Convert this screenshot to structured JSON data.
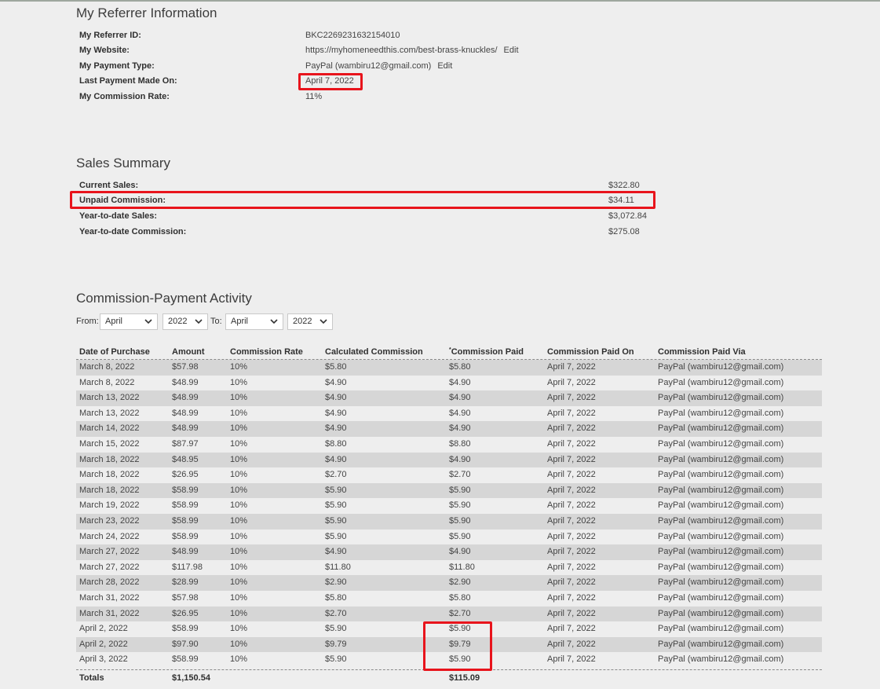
{
  "referrer": {
    "title": "My Referrer Information",
    "fields": [
      {
        "label": "My Referrer ID:",
        "value": "BKC2269231632154010"
      },
      {
        "label": "My Website:",
        "value": "https://myhomeneedthis.com/best-brass-knuckles/",
        "edit": "Edit"
      },
      {
        "label": "My Payment Type:",
        "value": "PayPal (wambiru12@gmail.com)",
        "edit": "Edit"
      },
      {
        "label": "Last Payment Made On:",
        "value": "April 7, 2022"
      },
      {
        "label": "My Commission Rate:",
        "value": "11%"
      }
    ]
  },
  "sales": {
    "title": "Sales Summary",
    "rows": [
      {
        "label": "Current Sales:",
        "value": "$322.80"
      },
      {
        "label": "Unpaid Commission:",
        "value": "$34.11"
      },
      {
        "label": "Year-to-date Sales:",
        "value": "$3,072.84"
      },
      {
        "label": "Year-to-date Commission:",
        "value": "$275.08"
      }
    ]
  },
  "activity": {
    "title": "Commission-Payment Activity",
    "from_label": "From:",
    "to_label": "To:",
    "from_month": "April",
    "from_year": "2022",
    "to_month": "April",
    "to_year": "2022",
    "headers": [
      "Date of Purchase",
      "Amount",
      "Commission Rate",
      "Calculated Commission",
      "Commission Paid",
      "Commission Paid On",
      "Commission Paid Via"
    ],
    "paid_marker": "*",
    "rows": [
      [
        "March 8, 2022",
        "$57.98",
        "10%",
        "$5.80",
        "$5.80",
        "April 7, 2022",
        "PayPal (wambiru12@gmail.com)"
      ],
      [
        "March 8, 2022",
        "$48.99",
        "10%",
        "$4.90",
        "$4.90",
        "April 7, 2022",
        "PayPal (wambiru12@gmail.com)"
      ],
      [
        "March 13, 2022",
        "$48.99",
        "10%",
        "$4.90",
        "$4.90",
        "April 7, 2022",
        "PayPal (wambiru12@gmail.com)"
      ],
      [
        "March 13, 2022",
        "$48.99",
        "10%",
        "$4.90",
        "$4.90",
        "April 7, 2022",
        "PayPal (wambiru12@gmail.com)"
      ],
      [
        "March 14, 2022",
        "$48.99",
        "10%",
        "$4.90",
        "$4.90",
        "April 7, 2022",
        "PayPal (wambiru12@gmail.com)"
      ],
      [
        "March 15, 2022",
        "$87.97",
        "10%",
        "$8.80",
        "$8.80",
        "April 7, 2022",
        "PayPal (wambiru12@gmail.com)"
      ],
      [
        "March 18, 2022",
        "$48.95",
        "10%",
        "$4.90",
        "$4.90",
        "April 7, 2022",
        "PayPal (wambiru12@gmail.com)"
      ],
      [
        "March 18, 2022",
        "$26.95",
        "10%",
        "$2.70",
        "$2.70",
        "April 7, 2022",
        "PayPal (wambiru12@gmail.com)"
      ],
      [
        "March 18, 2022",
        "$58.99",
        "10%",
        "$5.90",
        "$5.90",
        "April 7, 2022",
        "PayPal (wambiru12@gmail.com)"
      ],
      [
        "March 19, 2022",
        "$58.99",
        "10%",
        "$5.90",
        "$5.90",
        "April 7, 2022",
        "PayPal (wambiru12@gmail.com)"
      ],
      [
        "March 23, 2022",
        "$58.99",
        "10%",
        "$5.90",
        "$5.90",
        "April 7, 2022",
        "PayPal (wambiru12@gmail.com)"
      ],
      [
        "March 24, 2022",
        "$58.99",
        "10%",
        "$5.90",
        "$5.90",
        "April 7, 2022",
        "PayPal (wambiru12@gmail.com)"
      ],
      [
        "March 27, 2022",
        "$48.99",
        "10%",
        "$4.90",
        "$4.90",
        "April 7, 2022",
        "PayPal (wambiru12@gmail.com)"
      ],
      [
        "March 27, 2022",
        "$117.98",
        "10%",
        "$11.80",
        "$11.80",
        "April 7, 2022",
        "PayPal (wambiru12@gmail.com)"
      ],
      [
        "March 28, 2022",
        "$28.99",
        "10%",
        "$2.90",
        "$2.90",
        "April 7, 2022",
        "PayPal (wambiru12@gmail.com)"
      ],
      [
        "March 31, 2022",
        "$57.98",
        "10%",
        "$5.80",
        "$5.80",
        "April 7, 2022",
        "PayPal (wambiru12@gmail.com)"
      ],
      [
        "March 31, 2022",
        "$26.95",
        "10%",
        "$2.70",
        "$2.70",
        "April 7, 2022",
        "PayPal (wambiru12@gmail.com)"
      ],
      [
        "April 2, 2022",
        "$58.99",
        "10%",
        "$5.90",
        "$5.90",
        "April 7, 2022",
        "PayPal (wambiru12@gmail.com)"
      ],
      [
        "April 2, 2022",
        "$97.90",
        "10%",
        "$9.79",
        "$9.79",
        "April 7, 2022",
        "PayPal (wambiru12@gmail.com)"
      ],
      [
        "April 3, 2022",
        "$58.99",
        "10%",
        "$5.90",
        "$5.90",
        "April 7, 2022",
        "PayPal (wambiru12@gmail.com)"
      ]
    ],
    "totals": {
      "label": "Totals",
      "amount": "$1,150.54",
      "paid": "$115.09"
    }
  },
  "colors": {
    "highlight": "#e8141c",
    "row_stripe": "#d6d6d6",
    "background": "#eeeeee"
  },
  "icons": {
    "select_arrow": "chevron-down-icon"
  }
}
